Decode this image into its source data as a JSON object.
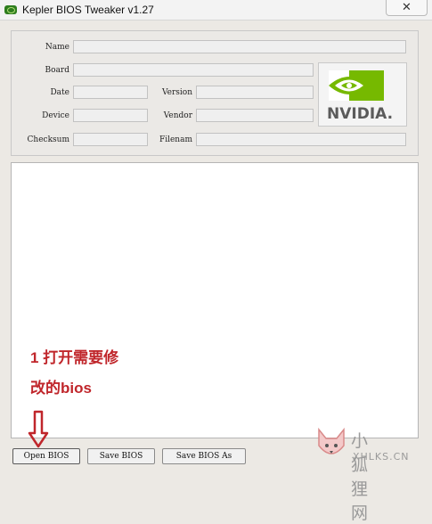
{
  "window": {
    "title": "Kepler BIOS Tweaker v1.27",
    "close_symbol": "✕"
  },
  "fields": {
    "name": {
      "label": "Name",
      "value": ""
    },
    "board": {
      "label": "Board",
      "value": ""
    },
    "date": {
      "label": "Date",
      "value": ""
    },
    "version": {
      "label": "Version",
      "value": ""
    },
    "device": {
      "label": "Device",
      "value": ""
    },
    "vendor": {
      "label": "Vendor",
      "value": ""
    },
    "checksum": {
      "label": "Checksum",
      "value": ""
    },
    "filename": {
      "label": "Filenam",
      "value": ""
    }
  },
  "logo": {
    "text": "NVIDIA.",
    "eye_color": "#76b900"
  },
  "annotation": {
    "line1": "1 打开需要修",
    "line2": "改的bios",
    "color": "#c0262b"
  },
  "buttons": {
    "open": "Open BIOS",
    "save": "Save BIOS",
    "save_as": "Save BIOS As"
  },
  "watermark": {
    "cn": "小狐狸网",
    "en": "XHLKS.CN"
  }
}
